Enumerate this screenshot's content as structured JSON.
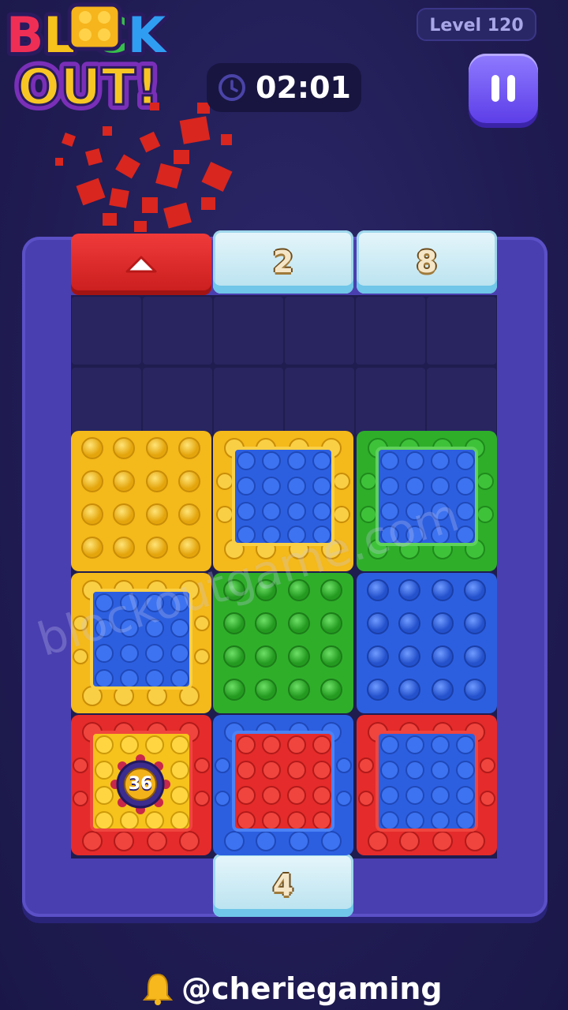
{
  "game": {
    "logo_line1": "BLOCK",
    "logo_line2": "OUT!",
    "level_label": "Level 120",
    "timer": "02:01"
  },
  "gates": {
    "top_middle_count": "2",
    "top_right_count": "8",
    "bottom_middle_count": "4"
  },
  "blocks": {
    "coin_value": "36"
  },
  "watermark": "blockoutgame.com",
  "handle": "@cheriegaming",
  "colors": {
    "red": "#e52b2b",
    "yellow": "#f6c21c",
    "green": "#2fae2a",
    "blue": "#2c5fe0",
    "ice": "#cfeef7",
    "frame": "#4a3fb0",
    "pause": "#6f54f5"
  }
}
